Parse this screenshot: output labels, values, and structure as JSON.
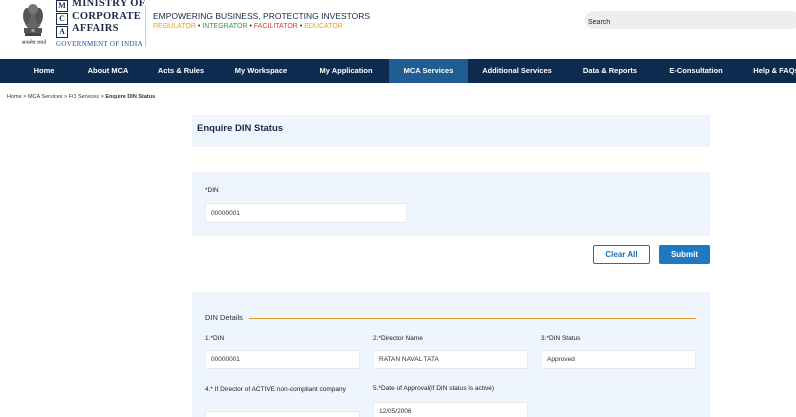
{
  "header": {
    "emblem_caption": "सत्यमेव जयते",
    "logo_letters": [
      "M",
      "C",
      "A"
    ],
    "logo_lines": [
      "MINISTRY OF",
      "CORPORATE",
      "AFFAIRS"
    ],
    "govt": "GOVERNMENT OF INDIA",
    "tagline": "EMPOWERING BUSINESS, PROTECTING INVESTORS",
    "roles": [
      "REGULATOR",
      "INTEGRATOR",
      "FACILITATOR",
      "EDUCATOR"
    ],
    "role_separator": "•",
    "search_placeholder": "Search"
  },
  "nav": {
    "items": [
      {
        "label": "Home"
      },
      {
        "label": "About MCA"
      },
      {
        "label": "Acts & Rules"
      },
      {
        "label": "My Workspace"
      },
      {
        "label": "My Application"
      },
      {
        "label": "MCA Services",
        "active": true
      },
      {
        "label": "Additional Services"
      },
      {
        "label": "Data & Reports"
      },
      {
        "label": "E-Consultation"
      },
      {
        "label": "Help & FAQs"
      }
    ]
  },
  "breadcrumb": {
    "items": [
      "Home",
      "MCA Services",
      "FO Services"
    ],
    "separator": ">",
    "current": "Enquire DIN Status"
  },
  "page": {
    "title": "Enquire DIN Status",
    "din_label": "*DIN",
    "din_value": "00000001",
    "clear_label": "Clear All",
    "submit_label": "Submit"
  },
  "details": {
    "title": "DIN Details",
    "fields": [
      {
        "label": "1.*DIN",
        "value": "00000001"
      },
      {
        "label": "2.*Director Name",
        "value": "RATAN NAVAL TATA"
      },
      {
        "label": "3.*DIN Status",
        "value": "Approved"
      },
      {
        "label": "4.* If Director of ACTIVE non-compliant company",
        "value": ""
      },
      {
        "label": "5.*Date of Approval(if DIN status is active)",
        "value": "12/05/2006"
      }
    ]
  },
  "colors": {
    "nav_bg": "#0c2b4f",
    "nav_active": "#1f5d93",
    "panel_bg": "#eef5fc",
    "accent_line": "#e29a2c",
    "submit_bg": "#1f78c2"
  }
}
